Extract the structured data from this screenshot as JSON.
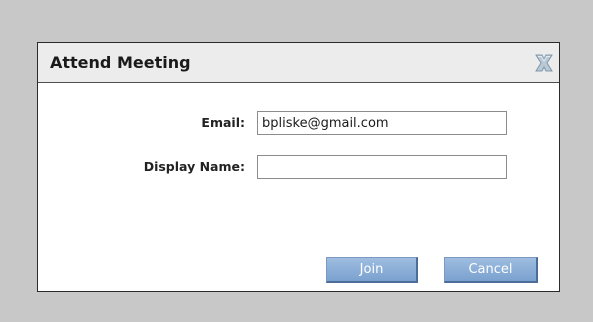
{
  "dialog": {
    "title": "Attend Meeting",
    "close_icon": "close-x-icon",
    "fields": {
      "email": {
        "label": "Email:",
        "value": "bpliske@gmail.com",
        "placeholder": ""
      },
      "display_name": {
        "label": "Display Name:",
        "value": "",
        "placeholder": ""
      }
    },
    "buttons": {
      "join_label": "Join",
      "cancel_label": "Cancel"
    }
  },
  "colors": {
    "backdrop": "#c8c8c8",
    "button": "#8fb2dc",
    "close_icon": "#a9bccc"
  }
}
